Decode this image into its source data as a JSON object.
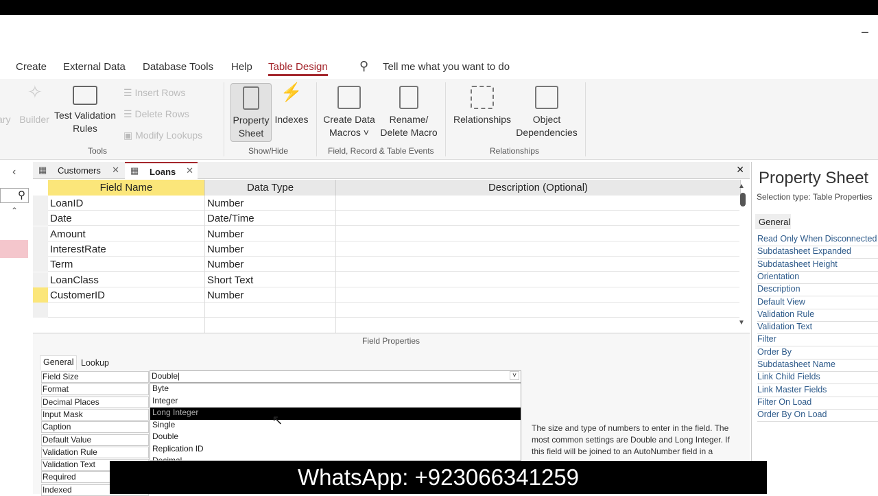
{
  "window": {
    "minimize": "–"
  },
  "menu": [
    {
      "label": "Create"
    },
    {
      "label": "External Data"
    },
    {
      "label": "Database Tools"
    },
    {
      "label": "Help"
    },
    {
      "label": "Table Design",
      "active": true
    }
  ],
  "search": {
    "placeholder": "Tell me what you want to do",
    "icon": "search-icon"
  },
  "ribbon": {
    "tools": {
      "label": "Tools",
      "primary_key_partial": "ary",
      "builder": "Builder",
      "test_validation": "Test Validation Rules",
      "insert_rows": "Insert Rows",
      "delete_rows": "Delete Rows",
      "modify_lookups": "Modify Lookups"
    },
    "showhide": {
      "label": "Show/Hide",
      "property_sheet": "Property Sheet",
      "indexes": "Indexes"
    },
    "events": {
      "label": "Field, Record & Table Events",
      "create_macros": "Create Data Macros ˅",
      "rename_macro": "Rename/ Delete Macro"
    },
    "relationships": {
      "label": "Relationships",
      "relationships": "Relationships",
      "object_dependencies": "Object Dependencies"
    }
  },
  "doc_tabs": [
    {
      "label": "Customers"
    },
    {
      "label": "Loans",
      "active": true
    }
  ],
  "grid": {
    "headers": [
      "Field Name",
      "Data Type",
      "Description (Optional)"
    ],
    "rows": [
      [
        "LoanID",
        "Number"
      ],
      [
        "Date",
        "Date/Time"
      ],
      [
        "Amount",
        "Number"
      ],
      [
        "InterestRate",
        "Number"
      ],
      [
        "Term",
        "Number"
      ],
      [
        "LoanClass",
        "Short Text"
      ],
      [
        "CustomerID",
        "Number"
      ]
    ]
  },
  "field_properties": {
    "title": "Field Properties",
    "tabs": [
      "General",
      "Lookup"
    ],
    "rows": [
      "Field Size",
      "Format",
      "Decimal Places",
      "Input Mask",
      "Caption",
      "Default Value",
      "Validation Rule",
      "Validation Text",
      "Required",
      "Indexed"
    ],
    "field_size_value": "Double",
    "options": [
      "Byte",
      "Integer",
      "Long Integer",
      "Single",
      "Double",
      "Replication ID",
      "Decimal"
    ],
    "selected_option": "Long Integer",
    "help": "The size and type of numbers to enter in the field. The most common settings are Double and Long Integer. If this field will be joined to an AutoNumber field in a"
  },
  "property_sheet": {
    "title": "Property Sheet",
    "selection_type": "Selection type:  Table Properties",
    "tab": "General",
    "rows": [
      "Read Only When Disconnected",
      "Subdatasheet Expanded",
      "Subdatasheet Height",
      "Orientation",
      "Description",
      "Default View",
      "Validation Rule",
      "Validation Text",
      "Filter",
      "Order By",
      "Subdatasheet Name",
      "Link Child Fields",
      "Link Master Fields",
      "Filter On Load",
      "Order By On Load"
    ]
  },
  "overlay": "WhatsApp: +923066341259",
  "colors": {
    "accent": "#a4262c",
    "selected_field": "#fff2a8"
  }
}
